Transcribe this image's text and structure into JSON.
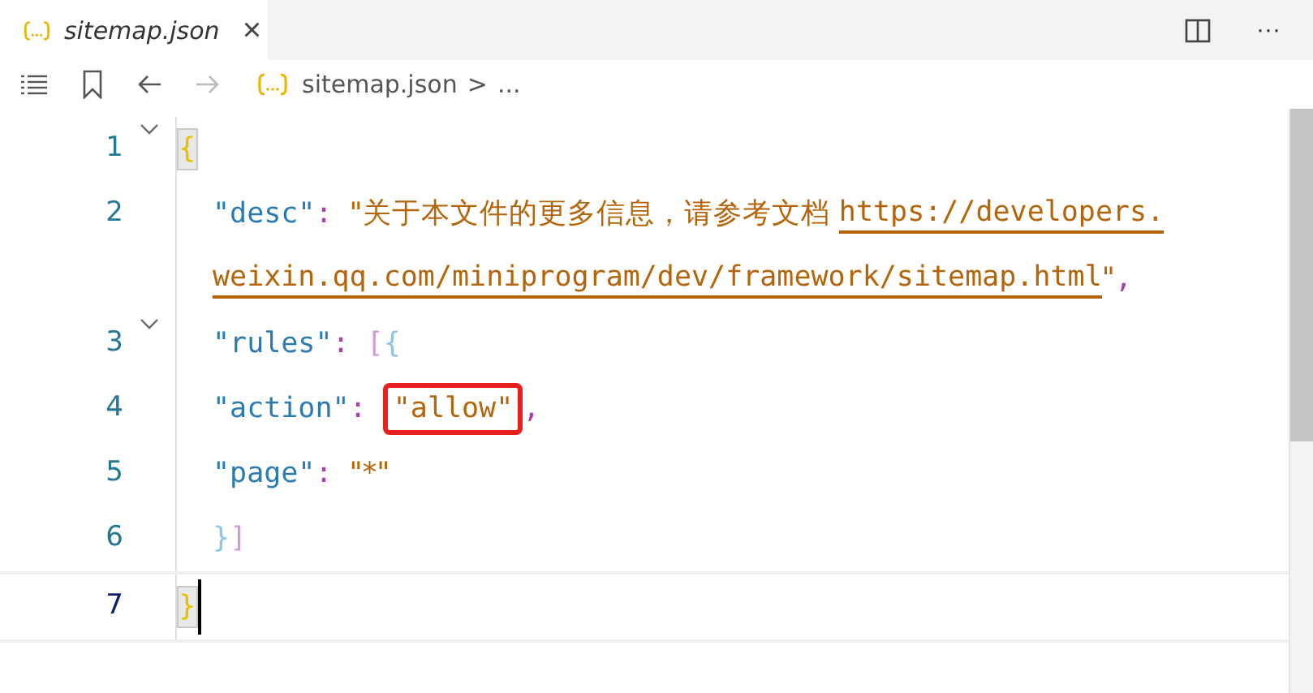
{
  "tab": {
    "title": "sitemap.json",
    "selected": true,
    "close": "×"
  },
  "toolbar": {
    "more": "···"
  },
  "breadcrumb": {
    "file": "sitemap.json",
    "separator": ">",
    "ellipsis": "..."
  },
  "lines": [
    {
      "number": "1",
      "foldable": true,
      "indented": false,
      "current": false,
      "parts": [
        {
          "tokens": [
            {
              "kind": "bracket",
              "text": "{",
              "color": "#e8c000",
              "matched": true
            }
          ]
        }
      ]
    },
    {
      "number": "2",
      "foldable": false,
      "indented": true,
      "current": false,
      "parts": [
        {
          "tokens": [
            {
              "kind": "key",
              "text": "\"desc\""
            },
            {
              "kind": "punct",
              "text": ": "
            },
            {
              "kind": "string",
              "text": "\"关于本文件的更多信息，请参考文档 "
            },
            {
              "kind": "link",
              "text": "https://developers."
            }
          ]
        },
        {
          "tokens": [
            {
              "kind": "link",
              "text": "weixin.qq.com/miniprogram/dev/framework/sitemap.html"
            },
            {
              "kind": "string",
              "text": "\""
            },
            {
              "kind": "punct",
              "text": ","
            }
          ]
        }
      ]
    },
    {
      "number": "3",
      "foldable": true,
      "indented": true,
      "current": false,
      "parts": [
        {
          "tokens": [
            {
              "kind": "key",
              "text": "\"rules\""
            },
            {
              "kind": "punct",
              "text": ": "
            },
            {
              "kind": "bracket",
              "text": "[",
              "color": "#d39bd6"
            },
            {
              "kind": "bracket",
              "text": "{",
              "color": "#8ec3ea"
            }
          ]
        }
      ]
    },
    {
      "number": "4",
      "foldable": false,
      "indented": true,
      "current": false,
      "parts": [
        {
          "tokens": [
            {
              "kind": "key",
              "text": "\"action\""
            },
            {
              "kind": "punct",
              "text": ": "
            },
            {
              "kind": "string",
              "text": "\"allow\"",
              "highlighted": true
            },
            {
              "kind": "punct",
              "text": ","
            }
          ]
        }
      ]
    },
    {
      "number": "5",
      "foldable": false,
      "indented": true,
      "current": false,
      "parts": [
        {
          "tokens": [
            {
              "kind": "key",
              "text": "\"page\""
            },
            {
              "kind": "punct",
              "text": ": "
            },
            {
              "kind": "string",
              "text": "\"*\""
            }
          ]
        }
      ]
    },
    {
      "number": "6",
      "foldable": false,
      "indented": true,
      "current": false,
      "parts": [
        {
          "tokens": [
            {
              "kind": "bracket",
              "text": "}",
              "color": "#8ec3ea"
            },
            {
              "kind": "bracket",
              "text": "]",
              "color": "#d39bd6"
            }
          ]
        }
      ]
    },
    {
      "number": "7",
      "foldable": false,
      "indented": false,
      "current": true,
      "parts": [
        {
          "tokens": [
            {
              "kind": "bracket",
              "text": "}",
              "color": "#e8c000",
              "matched": true
            }
          ]
        }
      ]
    }
  ]
}
